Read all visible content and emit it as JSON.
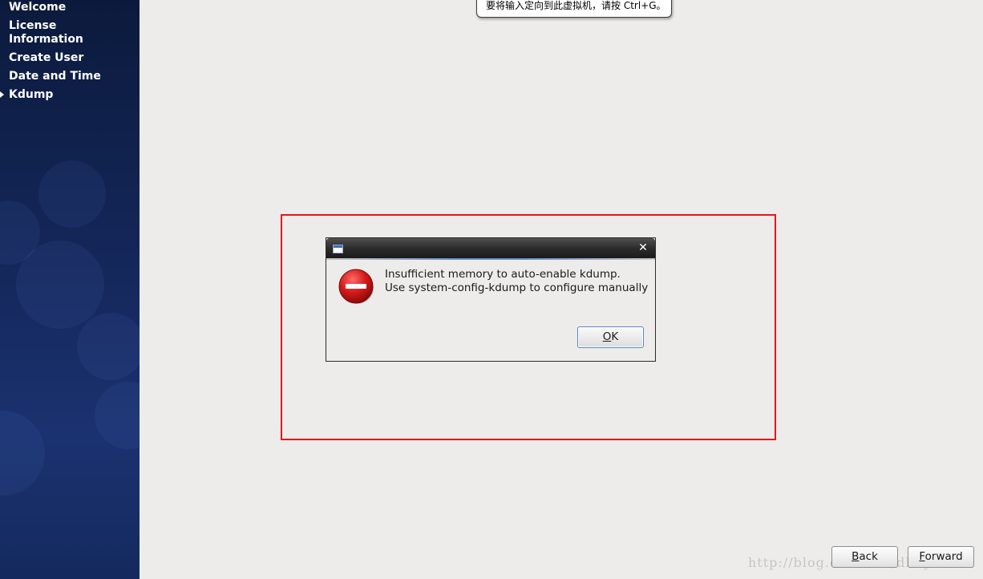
{
  "sidebar": {
    "items": [
      {
        "label": "Welcome"
      },
      {
        "label": "License Information"
      },
      {
        "label": "Create User"
      },
      {
        "label": "Date and Time"
      },
      {
        "label": "Kdump",
        "current": true
      }
    ]
  },
  "tooltip": {
    "text": "要将输入定向到此虚拟机，请按 Ctrl+G。"
  },
  "dialog": {
    "title": "",
    "message_line1": "Insufficient memory to auto-enable kdump.",
    "message_line2": "Use system-config-kdump to configure manually",
    "ok_mnemonic": "O",
    "ok_rest": "K",
    "icon": "error-icon"
  },
  "buttons": {
    "back_mnemonic": "B",
    "back_rest": "ack",
    "forward_mnemonic": "F",
    "forward_rest": "orward"
  },
  "watermark": {
    "text": "http://blog.csdn.net/dhnyxc"
  },
  "colors": {
    "annotation_box": "#e8141b",
    "sidebar": "#14275a",
    "background": "#edecea"
  }
}
